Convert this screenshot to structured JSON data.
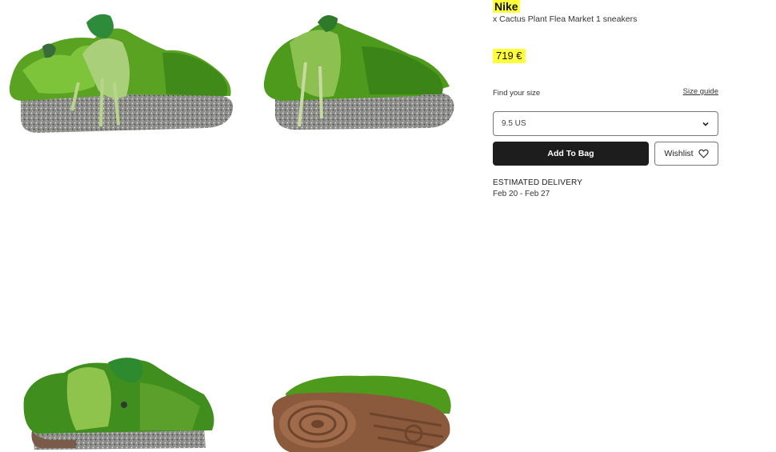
{
  "product": {
    "brand": "Nike",
    "name": "x Cactus Plant Flea Market 1 sneakers",
    "price": "719 €"
  },
  "size": {
    "label": "Find your size",
    "guide_link": "Size guide",
    "selected": "9.5 US"
  },
  "actions": {
    "add_to_bag": "Add To Bag",
    "wishlist": "Wishlist"
  },
  "delivery": {
    "label": "ESTIMATED DELIVERY",
    "dates": "Feb 20 - Feb 27"
  },
  "colors": {
    "highlight": "#ffff3c",
    "button_dark": "#1d1d1d",
    "fur_green": "#4e9a1c",
    "sole_speckle": "#8a8a88",
    "outsole_brown": "#8b5a3c"
  },
  "icons": [
    "chevron-down-icon",
    "heart-icon"
  ]
}
